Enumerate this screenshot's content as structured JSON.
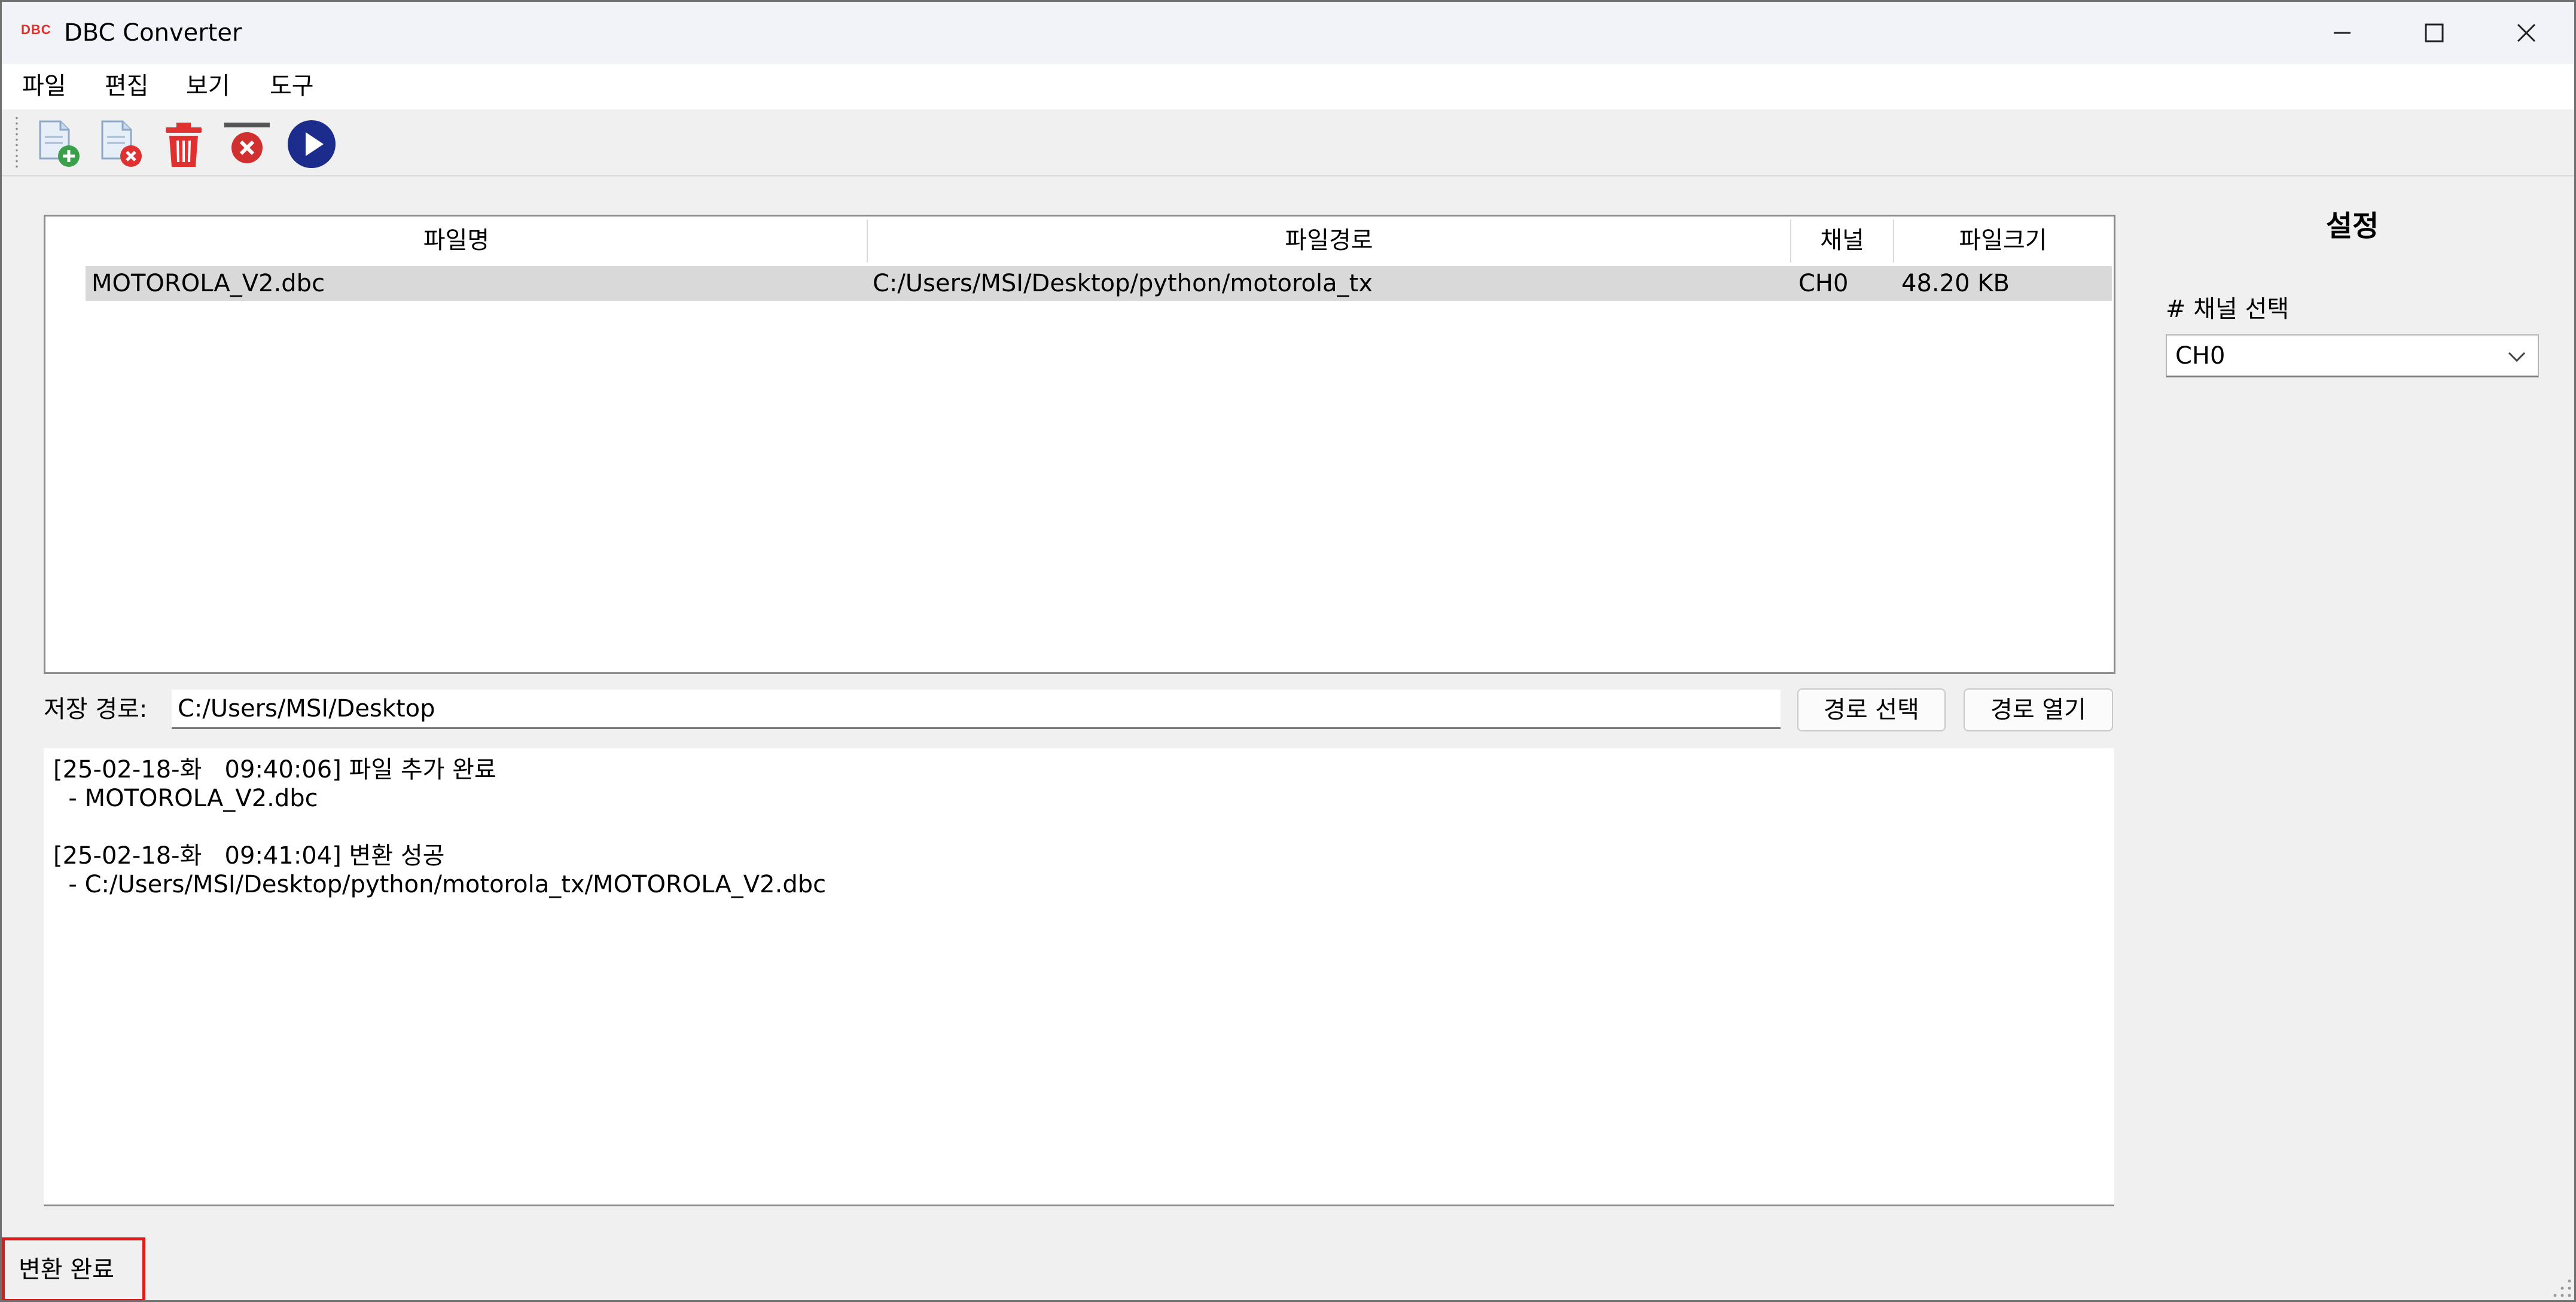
{
  "window": {
    "app_icon_text": "DBC",
    "title": "DBC Converter",
    "controls": [
      "minimize-icon",
      "maximize-icon",
      "close-icon"
    ]
  },
  "menu": [
    "파일",
    "편집",
    "보기",
    "도구"
  ],
  "toolbar": {
    "buttons": [
      {
        "name": "add-file-icon",
        "color": "#3aa04a"
      },
      {
        "name": "remove-file-icon",
        "color": "#e03030"
      },
      {
        "name": "trash-icon",
        "color": "#e03030"
      },
      {
        "name": "clear-icon",
        "color": "#d03030"
      },
      {
        "name": "run-icon",
        "color": "#1c2c8c"
      }
    ]
  },
  "file_table": {
    "columns": [
      "파일명",
      "파일경로",
      "채널",
      "파일크기"
    ],
    "rows": [
      [
        "MOTOROLA_V2.dbc",
        "C:/Users/MSI/Desktop/python/motorola_tx",
        "CH0",
        "48.20 KB"
      ]
    ]
  },
  "save_path": {
    "label": "저장 경로:",
    "value": "C:/Users/MSI/Desktop",
    "select_button": "경로 선택",
    "open_button": "경로 열기"
  },
  "log": [
    "[25-02-18-화   09:40:06] 파일 추가 완료",
    "  - MOTOROLA_V2.dbc",
    "",
    "[25-02-18-화   09:41:04] 변환 성공",
    "  - C:/Users/MSI/Desktop/python/motorola_tx/MOTOROLA_V2.dbc"
  ],
  "settings": {
    "title": "설정",
    "channel_label": "# 채널 선택",
    "channel_value": "CH0"
  },
  "status": {
    "text": "변환 완료",
    "highlight_color": "#e01818"
  }
}
